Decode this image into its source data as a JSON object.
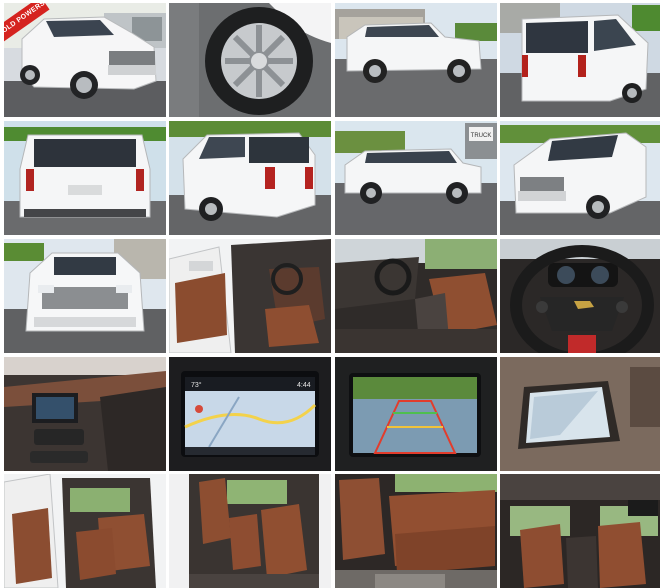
{
  "gallery": {
    "badge_text": "SOLD POWERS",
    "nav_status": {
      "temp": "73°",
      "time": "4:44"
    },
    "dealer_sign": "TRUCK"
  },
  "colors": {
    "vehicle": "#f4f5f6",
    "interior_leather": "#9c5436",
    "asphalt": "#5f6063",
    "sky": "#dfe9f1",
    "foliage": "#4d8d32"
  }
}
